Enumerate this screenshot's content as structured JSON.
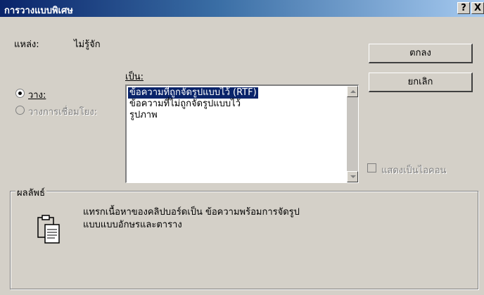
{
  "window": {
    "title": "การวางแบบพิเศษ",
    "help_glyph": "?",
    "close_glyph": "X"
  },
  "source": {
    "label": "แหล่ง:",
    "value": "ไม่รู้จัก"
  },
  "as_label": "เป็น:",
  "options": {
    "paste": "วาง:",
    "paste_link": "วางการเชื่อมโยง:",
    "selected": "paste"
  },
  "list": {
    "items": [
      "ข้อความที่ถูกจัดรูปแบบไว้ (RTF)",
      "ข้อความที่ไม่ถูกจัดรูปแบบไว้",
      "รูปภาพ"
    ],
    "selected_index": 0
  },
  "buttons": {
    "ok": "ตกลง",
    "cancel": "ยกเลิก"
  },
  "display_as_icon": {
    "label": "แสดงเป็นไอคอน",
    "checked": false,
    "enabled": false
  },
  "result": {
    "legend": "ผลลัพธ์",
    "line1": "แทรกเนื้อหาของคลิปบอร์ดเป็น ข้อความพร้อมการจัดรูป",
    "line2": "แบบแบบอักษรและตาราง",
    "icon": "clipboard-paste-icon"
  },
  "colors": {
    "title_start": "#0a246a",
    "title_end": "#a6caf0",
    "face": "#d4d0c8",
    "selection": "#0a246a",
    "disabled_text": "#808080"
  }
}
